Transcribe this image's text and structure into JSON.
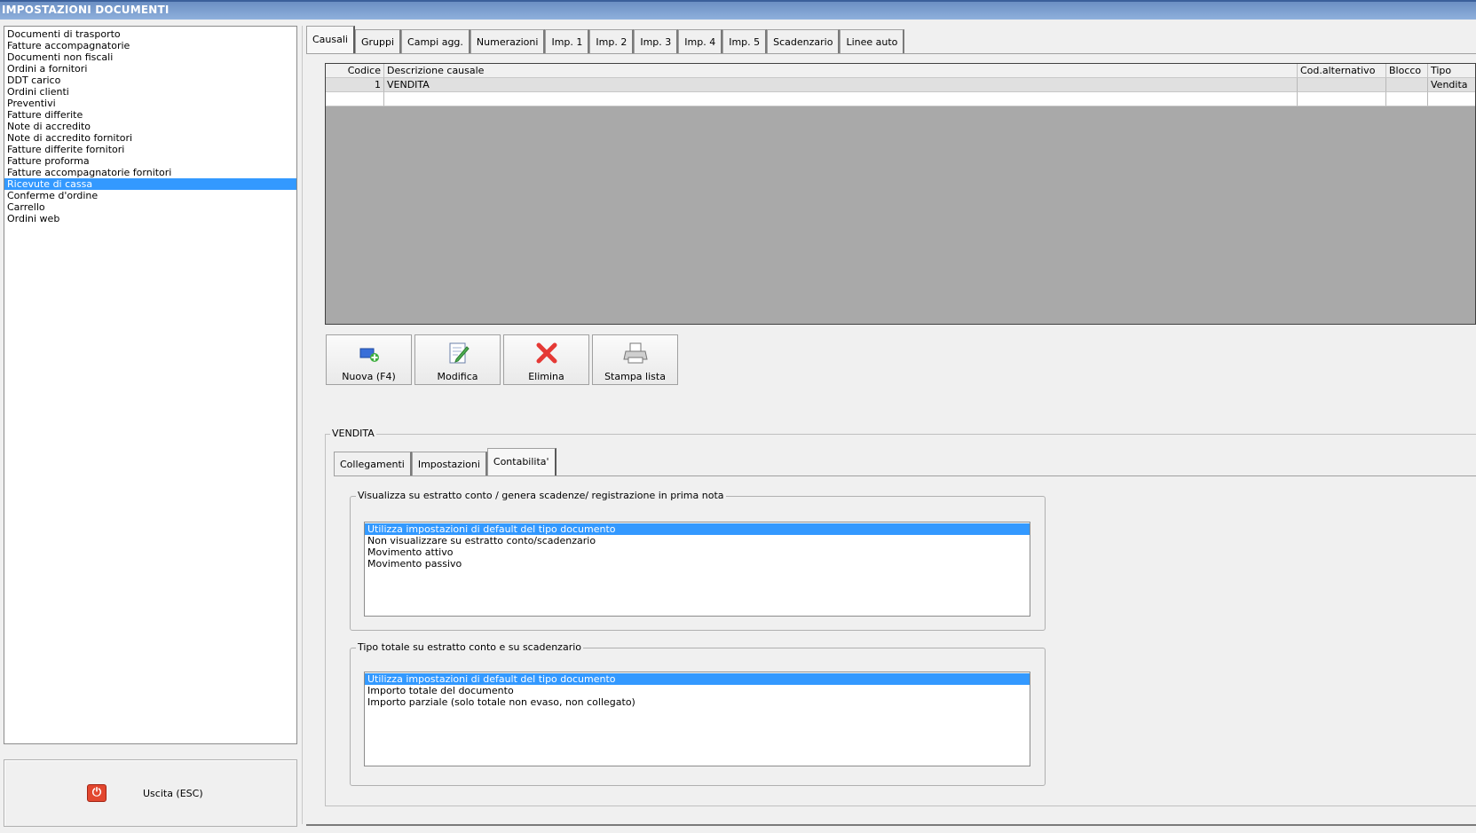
{
  "window": {
    "title": "IMPOSTAZIONI DOCUMENTI"
  },
  "doc_types": [
    {
      "label": "Documenti di trasporto"
    },
    {
      "label": "Fatture accompagnatorie"
    },
    {
      "label": "Documenti non fiscali"
    },
    {
      "label": "Ordini a fornitori"
    },
    {
      "label": "DDT carico"
    },
    {
      "label": "Ordini clienti"
    },
    {
      "label": "Preventivi"
    },
    {
      "label": "Fatture differite"
    },
    {
      "label": "Note di accredito"
    },
    {
      "label": "Note di accredito fornitori"
    },
    {
      "label": "Fatture differite fornitori"
    },
    {
      "label": "Fatture proforma"
    },
    {
      "label": "Fatture accompagnatorie fornitori"
    },
    {
      "label": "Ricevute di cassa",
      "selected": true
    },
    {
      "label": "Conferme d'ordine"
    },
    {
      "label": "Carrello"
    },
    {
      "label": "Ordini web"
    }
  ],
  "exit": {
    "label": "Uscita (ESC)",
    "icon": "power-icon",
    "color": "#e2472f"
  },
  "main_tabs": [
    "Causali",
    "Gruppi",
    "Campi agg.",
    "Numerazioni",
    "Imp. 1",
    "Imp. 2",
    "Imp. 3",
    "Imp. 4",
    "Imp. 5",
    "Scadenzario",
    "Linee auto"
  ],
  "main_tab_active": "Causali",
  "grid": {
    "columns": [
      "Codice",
      "Descrizione causale",
      "Cod.alternativo",
      "Blocco",
      "Tipo"
    ],
    "rows": [
      {
        "codice": "1",
        "descrizione": "VENDITA",
        "cod_alternativo": "",
        "blocco": "",
        "tipo": "Vendita"
      }
    ]
  },
  "toolbar": {
    "new": {
      "label": "Nuova (F4)",
      "icon": "add-document-icon"
    },
    "edit": {
      "label": "Modifica",
      "icon": "edit-document-icon"
    },
    "delete": {
      "label": "Elimina",
      "icon": "delete-x-icon"
    },
    "print": {
      "label": "Stampa lista",
      "icon": "printer-icon"
    }
  },
  "detail": {
    "title": "VENDITA",
    "tabs": [
      "Collegamenti",
      "Impostazioni",
      "Contabilita'"
    ],
    "active_tab": "Contabilita'",
    "group1": {
      "legend": "Visualizza su estratto conto / genera scadenze/ registrazione  in prima nota",
      "options": [
        "Utilizza impostazioni di default del tipo documento",
        "Non visualizzare su estratto conto/scadenzario",
        "Movimento attivo",
        "Movimento passivo"
      ],
      "selected": "Utilizza impostazioni di default del tipo documento"
    },
    "group2": {
      "legend": "Tipo totale su estratto conto e su scadenzario",
      "options": [
        "Utilizza impostazioni di default del tipo documento",
        "Importo totale del documento",
        "Importo parziale (solo totale non evaso, non collegato)"
      ],
      "selected": "Utilizza impostazioni di default del tipo documento"
    }
  },
  "colors": {
    "selection": "#3399ff",
    "title_bar": "#7a9ccf",
    "grid_empty": "#a9a9a9"
  }
}
